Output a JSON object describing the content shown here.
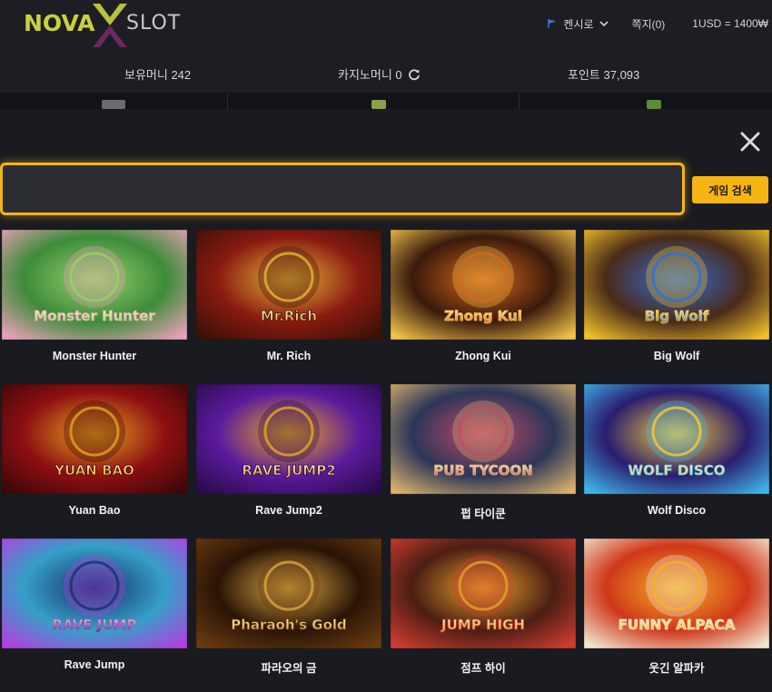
{
  "brand": {
    "name_left": "NOVA",
    "name_right": "SLOT"
  },
  "header": {
    "language": "켄시로",
    "messages": "쪽지(0)",
    "exchange_rate": "1USD = 1400₩"
  },
  "balance": {
    "holding_money": "보유머니 242",
    "casino_money": "카지노머니 0",
    "points": "포인트 37,093"
  },
  "search": {
    "placeholder": "",
    "value": "",
    "button_label": "게임 검색"
  },
  "games": [
    {
      "name": "Monster Hunter",
      "title_art": "Monster Hunter",
      "palette": [
        "#3d8c3a",
        "#9bd06a",
        "#e8a0b8"
      ]
    },
    {
      "name": "Mr. Rich",
      "title_art": "Mr.Rich",
      "palette": [
        "#8a1a10",
        "#e7b43a",
        "#3a1206"
      ]
    },
    {
      "name": "Zhong Kui",
      "title_art": "Zhong Kui",
      "palette": [
        "#3a1a0c",
        "#d8661c",
        "#f2c248"
      ]
    },
    {
      "name": "Big Wolf",
      "title_art": "Big Wolf",
      "palette": [
        "#4b2a18",
        "#2f6fd8",
        "#f0c02a"
      ]
    },
    {
      "name": "Yuan Bao",
      "title_art": "YUAN BAO",
      "palette": [
        "#8e0f12",
        "#e6a51e",
        "#3e0709"
      ]
    },
    {
      "name": "Rave Jump2",
      "title_art": "RAVE JUMP2",
      "palette": [
        "#5b1a9c",
        "#e9a81f",
        "#2a0b4c"
      ]
    },
    {
      "name": "펍 타이쿤",
      "title_art": "PUB TYCOON",
      "palette": [
        "#2b3658",
        "#c7486b",
        "#d9b06a"
      ]
    },
    {
      "name": "Wolf Disco",
      "title_art": "WOLF DISCO",
      "palette": [
        "#2a1d6e",
        "#f5c93a",
        "#3fb3e8"
      ]
    },
    {
      "name": "Rave Jump",
      "title_art": "RAVE JUMP",
      "palette": [
        "#35a0c8",
        "#1a2f6b",
        "#b23fe0"
      ]
    },
    {
      "name": "파라오의 금",
      "title_art": "Pharaoh's Gold",
      "palette": [
        "#2a1406",
        "#d9a642",
        "#6b3a10"
      ]
    },
    {
      "name": "점프 하이",
      "title_art": "JUMP HIGH",
      "palette": [
        "#4b1e14",
        "#e6a12a",
        "#d03c2e"
      ]
    },
    {
      "name": "웃긴 알파카",
      "title_art": "FUNNY ALPACA",
      "palette": [
        "#d0371a",
        "#f5b224",
        "#f0e6d0"
      ]
    }
  ],
  "colors": {
    "accent": "#f7b514",
    "background": "#17181c",
    "panel": "#1d1e23"
  },
  "icons": [
    "close-icon",
    "refresh-icon",
    "flag-icon",
    "chevron-down-icon"
  ]
}
